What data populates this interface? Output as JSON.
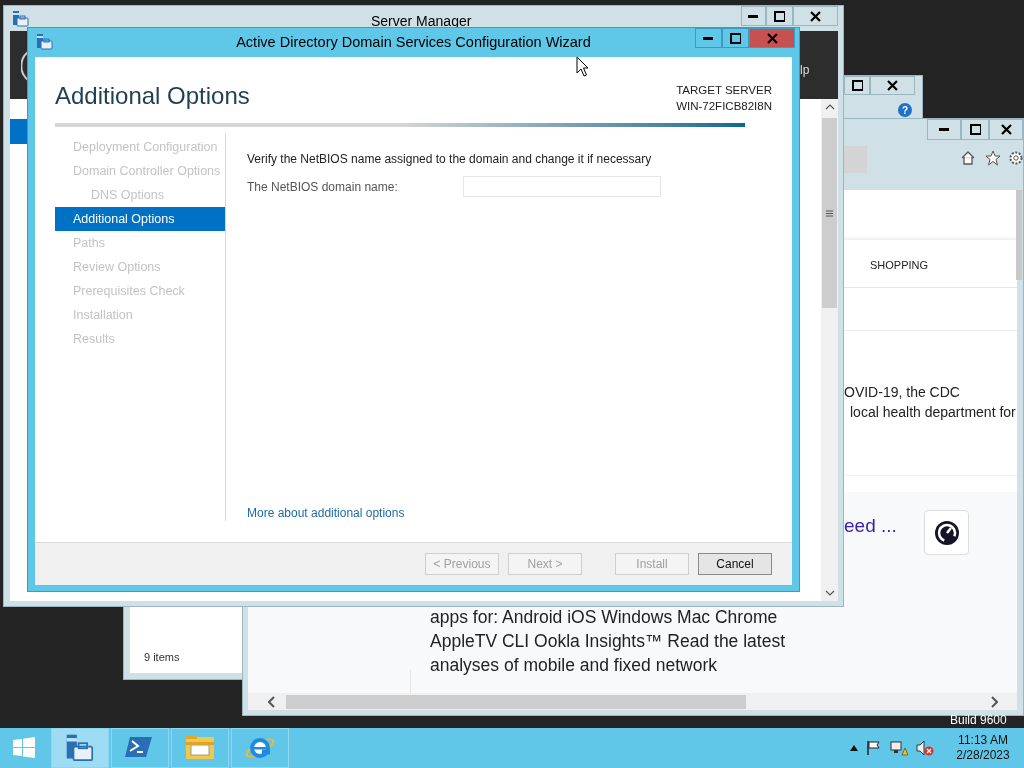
{
  "desktop_label": "Build 9600",
  "back_dialog": {
    "help": "?"
  },
  "explorer": {
    "status": "9 items"
  },
  "browser": {
    "category": "SHOPPING",
    "snippet_lines": [
      "OVID-19, the CDC",
      "local health department for"
    ],
    "link_fragment": "eed ...",
    "body_lines": [
      "apps for: Android iOS Windows Mac Chrome",
      "AppleTV CLI Ookla Insights™ Read the latest",
      "analyses of mobile and fixed network"
    ]
  },
  "server_manager": {
    "title": "Server Manager",
    "menu_fragment": "lp"
  },
  "wizard": {
    "title": "Active Directory Domain Services Configuration Wizard",
    "heading": "Additional Options",
    "target_label": "TARGET SERVER",
    "target_name": "WIN-72FICB82I8N",
    "steps": [
      {
        "label": "Deployment Configuration",
        "selected": false
      },
      {
        "label": "Domain Controller Options",
        "selected": false,
        "children": [
          {
            "label": "DNS Options",
            "selected": false
          }
        ]
      },
      {
        "label": "Additional Options",
        "selected": true
      },
      {
        "label": "Paths",
        "selected": false
      },
      {
        "label": "Review Options",
        "selected": false
      },
      {
        "label": "Prerequisites Check",
        "selected": false
      },
      {
        "label": "Installation",
        "selected": false
      },
      {
        "label": "Results",
        "selected": false
      }
    ],
    "prompt": "Verify the NetBIOS name assigned to the domain and change it if necessary",
    "field_label": "The NetBIOS domain name:",
    "more_link": "More about additional options",
    "buttons": [
      {
        "label": "< Previous",
        "disabled": true
      },
      {
        "label": "Next >",
        "disabled": true
      },
      {
        "label": "Install",
        "disabled": true
      },
      {
        "label": "Cancel",
        "disabled": false
      }
    ]
  },
  "taskbar": {
    "apps": [
      {
        "kind": "server-manager",
        "selected": true
      },
      {
        "kind": "powershell",
        "selected": false
      },
      {
        "kind": "file-explorer",
        "selected": false
      },
      {
        "kind": "internet-explorer",
        "selected": false
      }
    ],
    "time": "11:13 AM",
    "date": "2/28/2023"
  }
}
